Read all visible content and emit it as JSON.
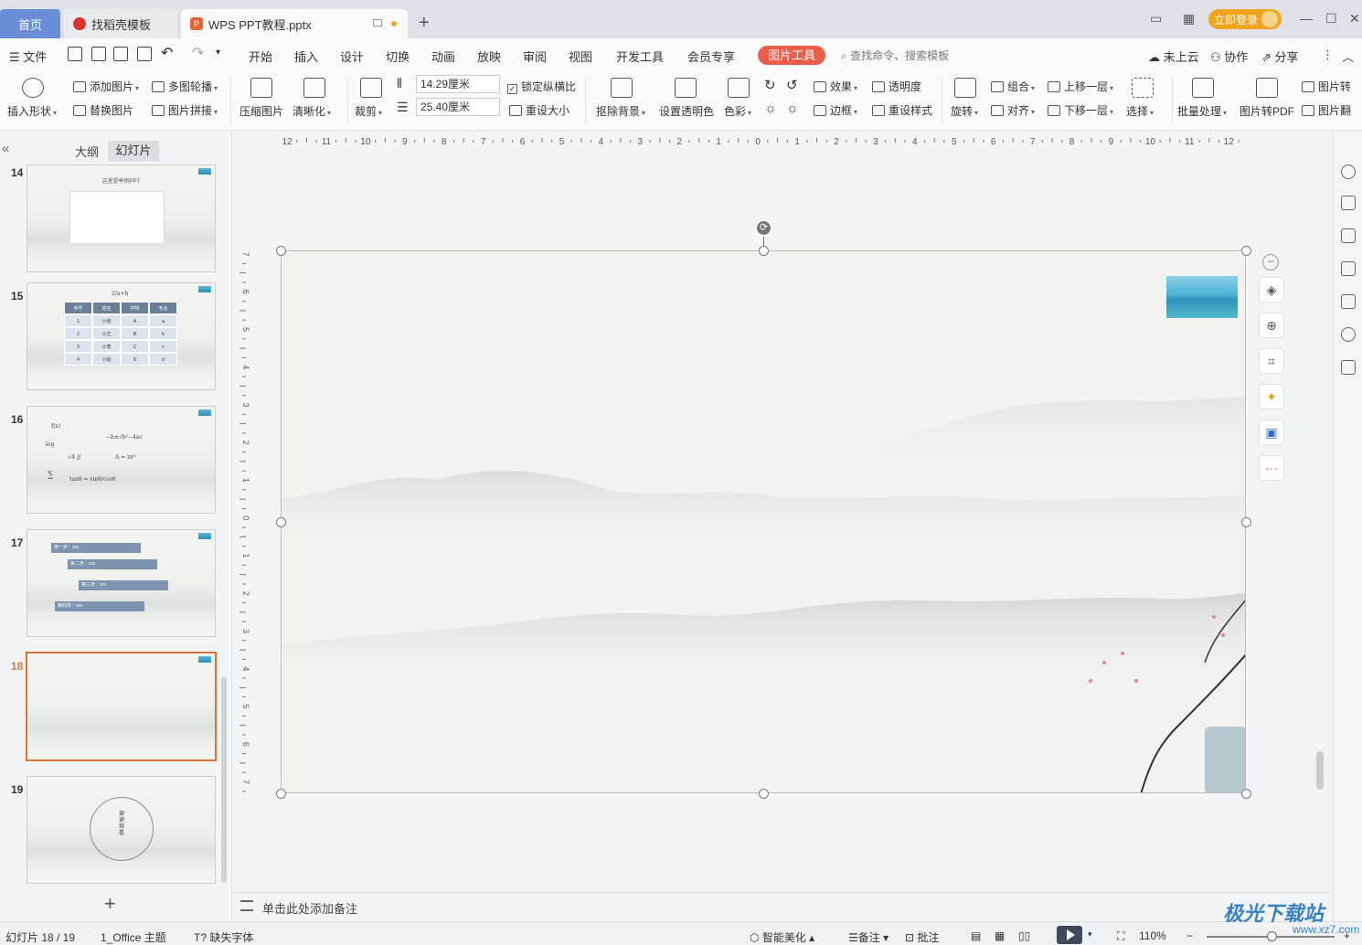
{
  "tabs": {
    "home": "首页",
    "template": "找稻壳模板",
    "doc": "WPS PPT教程.pptx",
    "login": "立即登录"
  },
  "menu": {
    "file": "文件",
    "items": [
      "开始",
      "插入",
      "设计",
      "切换",
      "动画",
      "放映",
      "审阅",
      "视图",
      "开发工具",
      "会员专享"
    ],
    "picture_tool": "图片工具",
    "search_placeholder": "查找命令、搜索模板",
    "cloud": "未上云",
    "collab": "协作",
    "share": "分享"
  },
  "ribbon": {
    "insert_shape": "插入形状",
    "add_picture": "添加图片",
    "multi_carousel": "多图轮播",
    "replace_picture": "替换图片",
    "picture_collage": "图片拼接",
    "compress": "压缩图片",
    "sharpen": "清晰化",
    "crop": "裁剪",
    "height": "14.29厘米",
    "width": "25.40厘米",
    "lock_ratio": "锁定纵横比",
    "reset_size": "重设大小",
    "remove_bg": "抠除背景",
    "set_transparent": "设置透明色",
    "color": "色彩",
    "effects": "效果",
    "transparency": "透明度",
    "border": "边框",
    "reset_style": "重设样式",
    "rotate": "旋转",
    "group": "组合",
    "align": "对齐",
    "bring_forward": "上移一层",
    "send_backward": "下移一层",
    "select": "选择",
    "batch": "批量处理",
    "to_pdf": "图片转PDF",
    "pic_convert": "图片转",
    "pic_translate": "图片翻"
  },
  "panel": {
    "outline_tab": "大纲",
    "slides_tab": "幻灯片",
    "slides": [
      {
        "num": "14",
        "title": "这里是举例PPT"
      },
      {
        "num": "15",
        "formula": "2/a+b",
        "headers": [
          "序号",
          "姓名",
          "学校",
          "专业"
        ],
        "rows": [
          [
            "1",
            "小张",
            "A",
            "a"
          ],
          [
            "2",
            "小王",
            "B",
            "b"
          ],
          [
            "3",
            "小李",
            "C",
            "c"
          ],
          [
            "4",
            "小赵",
            "D",
            "d"
          ]
        ]
      },
      {
        "num": "16"
      },
      {
        "num": "17",
        "steps": [
          "第一步：xxx",
          "第二步：xxx",
          "第三步：xxx",
          "第四步：xxx"
        ]
      },
      {
        "num": "18"
      },
      {
        "num": "19",
        "circle_text": "谢谢观看"
      }
    ]
  },
  "ruler_h": [
    "12",
    "11",
    "10",
    "9",
    "8",
    "7",
    "6",
    "5",
    "4",
    "3",
    "2",
    "1",
    "0",
    "1",
    "2",
    "3",
    "4",
    "5",
    "6",
    "7",
    "8",
    "9",
    "10",
    "11",
    "12"
  ],
  "ruler_v": [
    "7",
    "6",
    "5",
    "4",
    "3",
    "2",
    "1",
    "0",
    "1",
    "2",
    "3",
    "4",
    "5",
    "6",
    "7"
  ],
  "notes": "单击此处添加备注",
  "status": {
    "slide_count": "幻灯片 18 / 19",
    "theme": "1_Office 主题",
    "missing_font": "缺失字体",
    "smart_beautify": "智能美化",
    "notes": "备注",
    "comments": "批注",
    "zoom": "110%"
  },
  "watermark": {
    "main": "极光下载站",
    "sub": "www.xz7.com"
  }
}
